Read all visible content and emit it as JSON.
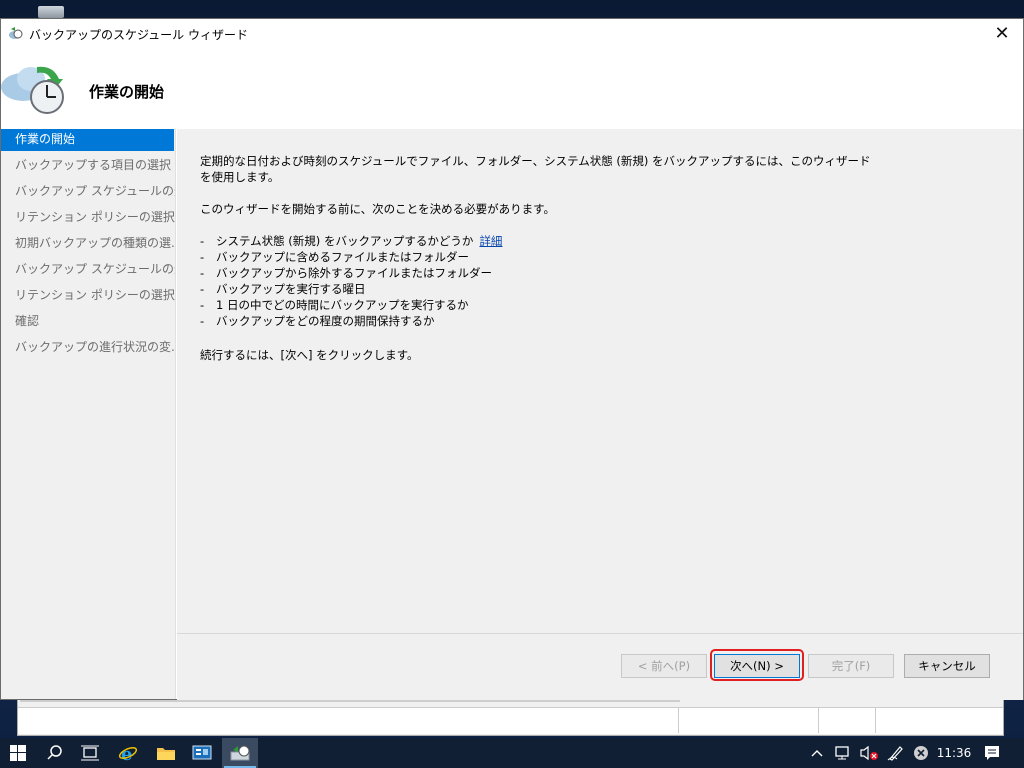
{
  "window": {
    "title": "バックアップのスケジュール ウィザード",
    "close_glyph": "✕"
  },
  "header": {
    "title": "作業の開始"
  },
  "steps": [
    {
      "label": "作業の開始",
      "active": true
    },
    {
      "label": "バックアップする項目の選択",
      "active": false
    },
    {
      "label": "バックアップ スケジュールの選...",
      "active": false
    },
    {
      "label": "リテンション ポリシーの選択 (...",
      "active": false
    },
    {
      "label": "初期バックアップの種類の選...",
      "active": false
    },
    {
      "label": "バックアップ スケジュールの選...",
      "active": false
    },
    {
      "label": "リテンション ポリシーの選択 (...",
      "active": false
    },
    {
      "label": "確認",
      "active": false
    },
    {
      "label": "バックアップの進行状況の変...",
      "active": false
    }
  ],
  "content": {
    "intro_line1": "定期的な日付および時刻のスケジュールでファイル、フォルダー、システム状態 (新規) をバックアップするには、このウィザード",
    "intro_line2": "を使用します。",
    "before_start": "このウィザードを開始する前に、次のことを決める必要があります。",
    "items": [
      {
        "dash": "-",
        "text": "システム状態 (新規) をバックアップするかどうか",
        "link": "詳細"
      },
      {
        "dash": "-",
        "text": "バックアップに含めるファイルまたはフォルダー"
      },
      {
        "dash": "-",
        "text": "バックアップから除外するファイルまたはフォルダー"
      },
      {
        "dash": "-",
        "text": "バックアップを実行する曜日"
      },
      {
        "dash": "-",
        "text": "1 日の中でどの時間にバックアップを実行するか"
      },
      {
        "dash": "-",
        "text": "バックアップをどの程度の期間保持するか"
      }
    ],
    "continue_text": "続行するには、[次へ] をクリックします。"
  },
  "buttons": {
    "back": "< 前へ(P)",
    "next": "次へ(N) >",
    "finish": "完了(F)",
    "cancel": "キャンセル"
  },
  "taskbar": {
    "clock": "11:36"
  },
  "colors": {
    "accent": "#0078d7",
    "highlight": "#e02020",
    "taskbar": "#101f34"
  }
}
